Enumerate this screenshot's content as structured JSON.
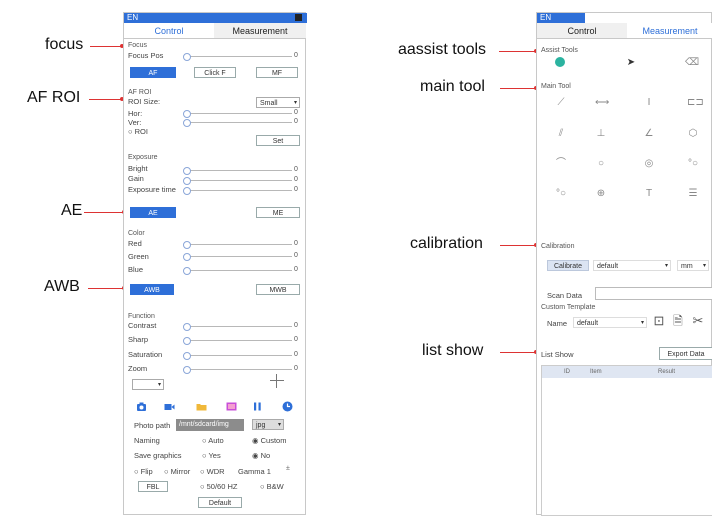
{
  "callouts": {
    "focus": "focus",
    "af_roi": "AF ROI",
    "ae": "AE",
    "awb": "AWB",
    "assist_tools": "aassist tools",
    "main_tool": "main tool",
    "calibration": "calibration",
    "list_show": "list show"
  },
  "left_panel": {
    "lang": "EN",
    "tabs": [
      "Control",
      "Measurement"
    ],
    "focus": {
      "title": "Focus",
      "pos_label": "Focus Pos",
      "pos_value": "0",
      "buttons": [
        "AF",
        "Click F",
        "MF"
      ]
    },
    "af_roi": {
      "title": "AF ROI",
      "size_label": "ROI Size:",
      "size_value": "Small",
      "hor_label": "Hor:",
      "hor_value": "0",
      "ver_label": "Ver:",
      "ver_value": "0",
      "roi_radio": "ROI",
      "set_button": "Set"
    },
    "exposure": {
      "title": "Exposure",
      "bright_label": "Bright",
      "bright_value": "0",
      "gain_label": "Gain",
      "gain_value": "0",
      "time_label": "Exposure time",
      "time_value": "0",
      "buttons": [
        "AE",
        "ME"
      ]
    },
    "color": {
      "title": "Color",
      "red_label": "Red",
      "red_value": "0",
      "green_label": "Green",
      "green_value": "0",
      "blue_label": "Blue",
      "blue_value": "0",
      "buttons": [
        "AWB",
        "MWB"
      ]
    },
    "function": {
      "title": "Function",
      "contrast_label": "Contrast",
      "contrast_value": "0",
      "sharp_label": "Sharp",
      "sharp_value": "0",
      "saturation_label": "Saturation",
      "saturation_value": "0",
      "zoom_label": "Zoom",
      "zoom_value": "0"
    },
    "photo_path_label": "Photo path",
    "photo_path_value": "/mnt/sdcard/img",
    "photo_format": "jpg",
    "naming_label": "Naming",
    "naming_auto": "Auto",
    "naming_custom": "Custom",
    "save_graphics_label": "Save graphics",
    "save_yes": "Yes",
    "save_no": "No",
    "flip": "Flip",
    "mirror": "Mirror",
    "wdr": "WDR",
    "gamma_label": "Gamma",
    "gamma_value": "1",
    "fbl_button": "FBL",
    "hz_radio": "50/60 HZ",
    "bw_radio": "B&W",
    "default_button": "Default",
    "accent_color": "#2e6fd8"
  },
  "right_panel": {
    "lang": "EN",
    "tabs": [
      "Control",
      "Measurement"
    ],
    "assist_tools_title": "Assist Tools",
    "main_tool_title": "Main Tool",
    "calibration_title": "Calibration",
    "calibrate_button": "Calibrate",
    "calibration_value": "default",
    "unit_value": "mm",
    "scan_data_label": "Scan Data",
    "custom_template_title": "Custom Template",
    "name_label": "Name",
    "name_value": "default",
    "list_show_label": "List Show",
    "export_button": "Export Data",
    "table_headers": [
      "ID",
      "Item",
      "Result"
    ]
  }
}
